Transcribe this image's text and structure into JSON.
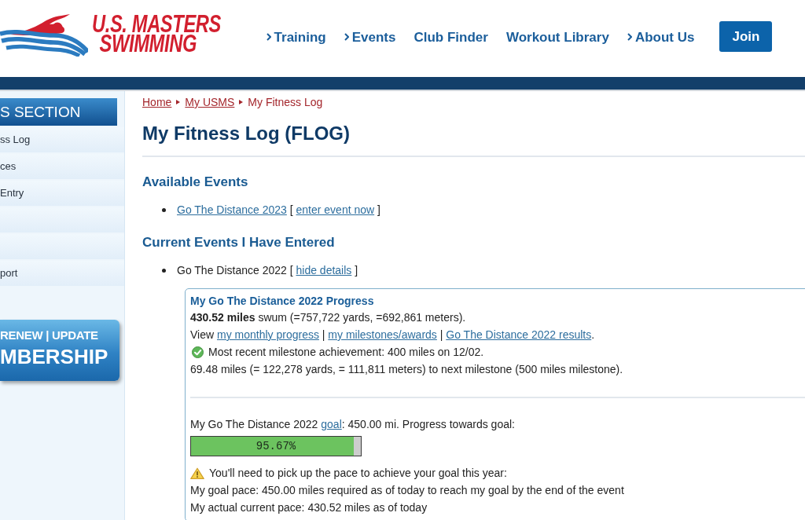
{
  "header": {
    "logo": {
      "line_1": "U.S. MASTERS",
      "line_2": "SWIMMING"
    },
    "nav": [
      {
        "label": "Training",
        "has_submenu": true
      },
      {
        "label": "Events",
        "has_submenu": true
      },
      {
        "label": "Club Finder",
        "has_submenu": false
      },
      {
        "label": "Workout Library",
        "has_submenu": false
      },
      {
        "label": "About Us",
        "has_submenu": true
      }
    ],
    "join_button": "Join"
  },
  "sidebar": {
    "title": "S SECTION",
    "items": [
      {
        "kind": "labeled",
        "label": "ss Log"
      },
      {
        "kind": "labeled",
        "label": "ces"
      },
      {
        "kind": "labeled",
        "label": "Entry"
      },
      {
        "kind": "blank"
      },
      {
        "kind": "blank"
      },
      {
        "kind": "labeled",
        "label": "port"
      }
    ],
    "banner": {
      "line_1": "RENEW | UPDATE",
      "line_2": "MBERSHIP"
    }
  },
  "main": {
    "breadcrumb": [
      {
        "label": "Home",
        "current": false
      },
      {
        "label": "My USMS",
        "current": false
      },
      {
        "label": "My Fitness Log",
        "current": true
      }
    ],
    "title": "My Fitness Log (FLOG)",
    "sections": [
      {
        "heading": "Available Events",
        "items": [
          {
            "segments": [
              {
                "kind": "link",
                "text": "Go The Distance 2023"
              },
              {
                "kind": "text",
                "text": " [ "
              },
              {
                "kind": "link",
                "text": "enter event now"
              },
              {
                "kind": "text",
                "text": " ]"
              }
            ]
          }
        ]
      },
      {
        "heading": "Current Events I Have Entered",
        "items": [
          {
            "segments": [
              {
                "kind": "text",
                "text": "Go The Distance 2022 [ "
              },
              {
                "kind": "link",
                "text": "hide details"
              },
              {
                "kind": "text",
                "text": " ]"
              }
            ]
          }
        ]
      }
    ],
    "progress_panel": {
      "title": "My Go The Distance 2022 Progress",
      "total": "**430.52 miles** swum (=757,722 yards, =692,861 meters).",
      "links_line": [
        {
          "kind": "text",
          "text": "View "
        },
        {
          "kind": "link",
          "text": "my monthly progress"
        },
        {
          "kind": "text",
          "text": " | "
        },
        {
          "kind": "link",
          "text": "my milestones/awards"
        },
        {
          "kind": "text",
          "text": " | "
        },
        {
          "kind": "link",
          "text": "Go The Distance 2022 results"
        },
        {
          "kind": "text",
          "text": "."
        }
      ],
      "milestone": {
        "kind": "success",
        "text": "Most recent milestone achievement: 400 miles on 12/02."
      },
      "next_milestone": "69.48 miles (= 122,278 yards, = 111,811 meters) to next milestone (500 miles milestone).",
      "goal_line": [
        {
          "kind": "text",
          "text": "My Go The Distance 2022 "
        },
        {
          "kind": "link",
          "text": "goal"
        },
        {
          "kind": "text",
          "text": ": 450.00 mi. Progress towards goal:"
        }
      ],
      "goal_progress": {
        "level": 0.9567,
        "reading": "95.67%"
      },
      "pace_notice": {
        "kind": "warning",
        "text": "You'll need to pick up the pace to achieve your goal this year:"
      },
      "pace_lines": [
        "My goal pace: 450.00 miles required as of today to reach my goal by the end of the event",
        "My actual current pace: 430.52 miles as of today"
      ]
    }
  }
}
